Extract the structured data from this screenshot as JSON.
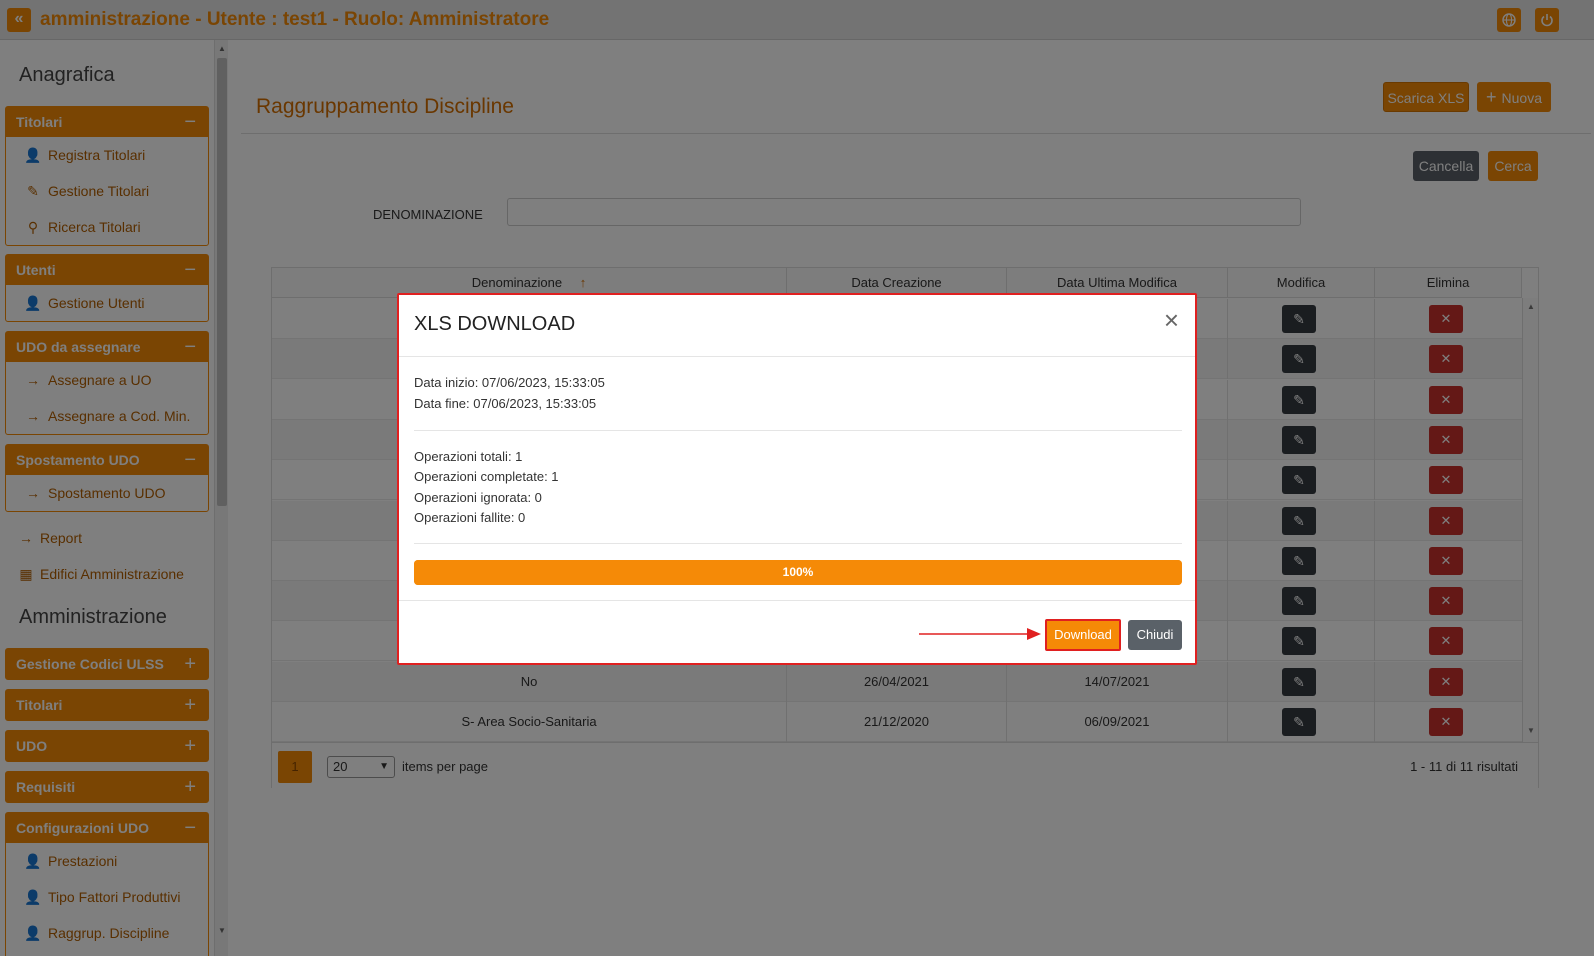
{
  "header": {
    "title": "amministrazione - Utente : test1 - Ruolo: Amministratore",
    "accent_color": "#f58a07"
  },
  "sidebar": {
    "section_anagrafica": "Anagrafica",
    "section_amministrazione": "Amministrazione",
    "panels": [
      {
        "title": "Titolari",
        "toggle": "−",
        "items": [
          {
            "label": "Registra Titolari",
            "icon": "user-edit-icon"
          },
          {
            "label": "Gestione Titolari",
            "icon": "edit-icon"
          },
          {
            "label": "Ricerca Titolari",
            "icon": "search-icon"
          }
        ]
      },
      {
        "title": "Utenti",
        "toggle": "−",
        "items": [
          {
            "label": "Gestione Utenti",
            "icon": "user-edit-icon"
          }
        ]
      },
      {
        "title": "UDO da assegnare",
        "toggle": "−",
        "items": [
          {
            "label": "Assegnare a UO",
            "icon": "arrow-right-icon"
          },
          {
            "label": "Assegnare a Cod. Min.",
            "icon": "arrow-right-icon"
          }
        ]
      },
      {
        "title": "Spostamento UDO",
        "toggle": "−",
        "items": [
          {
            "label": "Spostamento UDO",
            "icon": "arrow-right-icon"
          }
        ]
      }
    ],
    "links": [
      {
        "label": "Report",
        "icon": "arrow-right-icon"
      },
      {
        "label": "Edifici Amministrazione",
        "icon": "building-icon"
      }
    ],
    "admin_panels": [
      {
        "title": "Gestione Codici ULSS",
        "toggle": "+"
      },
      {
        "title": "Titolari",
        "toggle": "+"
      },
      {
        "title": "UDO",
        "toggle": "+"
      },
      {
        "title": "Requisiti",
        "toggle": "+"
      }
    ],
    "config_panel": {
      "title": "Configurazioni UDO",
      "toggle": "−",
      "items": [
        {
          "label": "Prestazioni",
          "icon": "user-edit-icon"
        },
        {
          "label": "Tipo Fattori Produttivi",
          "icon": "user-edit-icon"
        },
        {
          "label": "Raggrup. Discipline",
          "icon": "user-edit-icon"
        }
      ]
    }
  },
  "main": {
    "page_title": "Raggruppamento Discipline",
    "buttons": {
      "scarica_xls": "Scarica XLS",
      "nuova": "Nuova",
      "cancella": "Cancella",
      "cerca": "Cerca"
    },
    "filter": {
      "label": "DENOMINAZIONE",
      "value": ""
    },
    "grid": {
      "columns": [
        "Denominazione",
        "Data Creazione",
        "Data Ultima Modifica",
        "Modifica",
        "Elimina"
      ],
      "sort_indicator": "↑",
      "rows": [
        {
          "denominazione": "",
          "creazione": "",
          "modifica": ""
        },
        {
          "denominazione": "",
          "creazione": "",
          "modifica": ""
        },
        {
          "denominazione": "",
          "creazione": "",
          "modifica": ""
        },
        {
          "denominazione": "",
          "creazione": "",
          "modifica": ""
        },
        {
          "denominazione": "",
          "creazione": "",
          "modifica": ""
        },
        {
          "denominazione": "",
          "creazione": "",
          "modifica": ""
        },
        {
          "denominazione": "",
          "creazione": "",
          "modifica": ""
        },
        {
          "denominazione": "",
          "creazione": "",
          "modifica": ""
        },
        {
          "denominazione": "",
          "creazione": "",
          "modifica": ""
        },
        {
          "denominazione": "No",
          "creazione": "26/04/2021",
          "modifica": "14/07/2021"
        },
        {
          "denominazione": "S- Area Socio-Sanitaria",
          "creazione": "21/12/2020",
          "modifica": "06/09/2021"
        }
      ]
    },
    "pager": {
      "current_page": "1",
      "page_size": "20",
      "items_per_page": "items per page",
      "results": "1 - 11 di 11 risultati"
    }
  },
  "modal": {
    "title": "XLS DOWNLOAD",
    "close": "×",
    "data_inizio": "Data inizio: 07/06/2023, 15:33:05",
    "data_fine": "Data fine: 07/06/2023, 15:33:05",
    "op_totali": "Operazioni totali: 1",
    "op_completate": "Operazioni completate: 1",
    "op_ignorata": "Operazioni ignorata: 0",
    "op_fallite": "Operazioni fallite: 0",
    "progress_percent": 100,
    "progress_label": "100%",
    "download": "Download",
    "chiudi": "Chiudi",
    "highlight_color": "#e02020"
  }
}
